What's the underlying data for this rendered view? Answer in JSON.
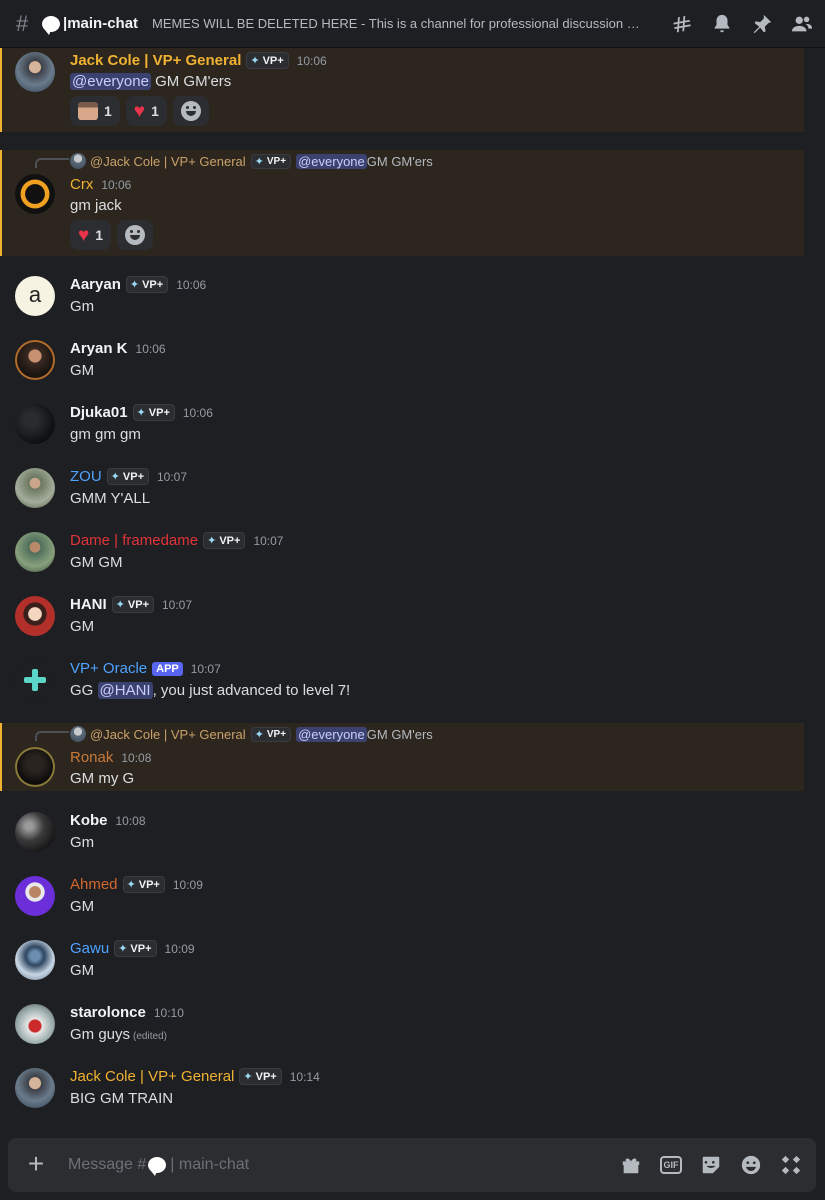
{
  "header": {
    "hash": "#",
    "channel": "|main-chat",
    "topic": "MEMES WILL BE DELETED HERE - This is a channel for professional discussion a..."
  },
  "messages": [
    {
      "user": "Jack Cole | VP+ General",
      "color": "#f0b232",
      "tag": "VP+",
      "time": "10:06",
      "content_mention": "@everyone",
      "content": " GM GM'ers",
      "reactions": [
        {
          "emoji": "face",
          "count": "1"
        },
        {
          "emoji": "heart",
          "count": "1"
        }
      ],
      "highlighted": true
    },
    {
      "reply_user": "@Jack Cole | VP+ General",
      "reply_tag": "VP+",
      "reply_mention": "@everyone",
      "reply_text": " GM GM'ers",
      "user": "Crx",
      "color": "#f0b232",
      "time": "10:06",
      "content": "gm jack",
      "reactions": [
        {
          "emoji": "heart",
          "count": "1"
        }
      ],
      "highlighted": true
    },
    {
      "user": "Aaryan",
      "color": "#f2f3f5",
      "tag": "VP+",
      "time": "10:06",
      "content": "Gm"
    },
    {
      "user": "Aryan K",
      "color": "#f2f3f5",
      "time": "10:06",
      "content": "GM"
    },
    {
      "user": "Djuka01",
      "color": "#f2f3f5",
      "tag": "VP+",
      "time": "10:06",
      "content": "gm gm gm"
    },
    {
      "user": "ZOU",
      "color": "#4ea3ff",
      "tag": "VP+",
      "time": "10:07",
      "content": "GMM Y'ALL"
    },
    {
      "user": "Dame | framedame",
      "color": "#e0343a",
      "tag": "VP+",
      "time": "10:07",
      "content": "GM GM"
    },
    {
      "user": "HANI",
      "color": "#f2f3f5",
      "tag": "VP+",
      "time": "10:07",
      "content": "GM"
    },
    {
      "user": "VP+ Oracle",
      "color": "#4ea3ff",
      "app_tag": "APP",
      "time": "10:07",
      "content_prefix": "GG ",
      "content_mention": "@HANI",
      "content": ", you just advanced to level 7!"
    },
    {
      "reply_user": "@Jack Cole | VP+ General",
      "reply_tag": "VP+",
      "reply_mention": "@everyone",
      "reply_text": " GM GM'ers",
      "user": "Ronak",
      "color": "#c97a3a",
      "time": "10:08",
      "content": "GM my G",
      "highlighted": true
    },
    {
      "user": "Kobe",
      "color": "#f2f3f5",
      "time": "10:08",
      "content": "Gm"
    },
    {
      "user": "Ahmed",
      "color": "#d6672e",
      "tag": "VP+",
      "time": "10:09",
      "content": "GM"
    },
    {
      "user": "Gawu",
      "color": "#4ea3ff",
      "tag": "VP+",
      "time": "10:09",
      "content": "GM"
    },
    {
      "user": "starolonce",
      "color": "#f2f3f5",
      "time": "10:10",
      "content": "Gm guys",
      "edited": "(edited)"
    },
    {
      "user": "Jack Cole | VP+ General",
      "color": "#f0b232",
      "tag": "VP+",
      "time": "10:14",
      "content": "BIG GM TRAIN"
    }
  ],
  "composer": {
    "placeholder_prefix": "Message #",
    "placeholder_channel": "| main-chat",
    "plus": "+",
    "gif": "GIF"
  },
  "icons": [
    "threads-icon",
    "bell-icon",
    "pin-icon",
    "members-icon",
    "gift-icon",
    "gif-icon",
    "sticker-icon",
    "emoji-icon",
    "apps-icon"
  ]
}
